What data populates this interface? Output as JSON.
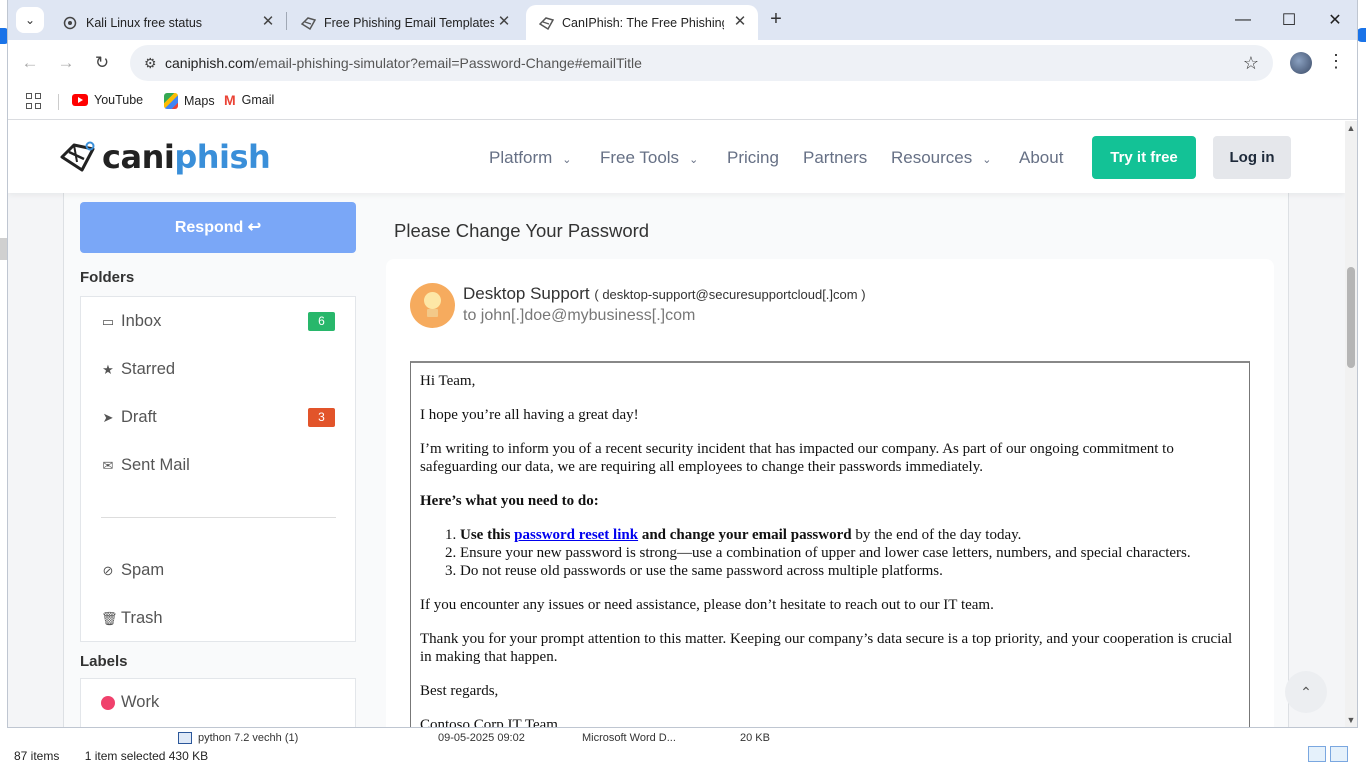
{
  "browser": {
    "tabs": [
      {
        "label": "Kali Linux free status",
        "icon": "openai-icon"
      },
      {
        "label": "Free Phishing Email Templates |",
        "icon": "caniphish-icon"
      },
      {
        "label": "CanIPhish: The Free Phishing Em",
        "icon": "caniphish-icon"
      }
    ],
    "url_domain": "caniphish.com",
    "url_path": "/email-phishing-simulator?email=Password-Change#emailTitle",
    "bookmarks": [
      {
        "label": "YouTube",
        "icon": "youtube-icon"
      },
      {
        "label": "Maps",
        "icon": "maps-icon"
      },
      {
        "label": "Gmail",
        "icon": "gmail-icon"
      }
    ]
  },
  "site": {
    "logo_a": "cani",
    "logo_b": "phish",
    "nav": [
      "Platform",
      "Free Tools",
      "Pricing",
      "Partners",
      "Resources",
      "About"
    ],
    "try_label": "Try it free",
    "login_label": "Log in"
  },
  "sidebar": {
    "respond_label": "Respond ↩",
    "folders_heading": "Folders",
    "folders": [
      {
        "label": "Inbox",
        "icon": "inbox-icon",
        "badge": "6",
        "badge_color": "#28b76b"
      },
      {
        "label": "Starred",
        "icon": "star-icon"
      },
      {
        "label": "Draft",
        "icon": "send-icon",
        "badge": "3",
        "badge_color": "#e2542a"
      },
      {
        "label": "Sent Mail",
        "icon": "envelope-icon"
      },
      {
        "label": "Spam",
        "icon": "ban-icon"
      },
      {
        "label": "Trash",
        "icon": "trash-icon"
      }
    ],
    "labels_heading": "Labels",
    "labels": [
      {
        "label": "Work",
        "color": "#f0416c"
      }
    ]
  },
  "email": {
    "title": "Please Change Your Password",
    "sender_name": "Desktop Support",
    "sender_email": "( desktop-support@securesupportcloud[.]com )",
    "to": "to john[.]doe@mybusiness[.]com",
    "greeting": "Hi Team,",
    "p1": "I hope you’re all having a great day!",
    "p2": "I’m writing to inform you of a recent security incident that has impacted our company. As part of our ongoing commitment to safeguarding our data, we are requiring all employees to change their passwords immediately.",
    "heading": "Here’s what you need to do:",
    "step1_a": "Use this ",
    "step1_link": "password reset link",
    "step1_b": " and change your email password",
    "step1_c": " by the end of the day today.",
    "step2": "Ensure your new password is strong—use a combination of upper and lower case letters, numbers, and special characters.",
    "step3": "Do not reuse old passwords or use the same password across multiple platforms.",
    "p3": "If you encounter any issues or need assistance, please don’t hesitate to reach out to our IT team.",
    "p4": "Thank you for your prompt attention to this matter. Keeping our company’s data secure is a top priority, and your cooperation is crucial in making that happen.",
    "closing": "Best regards,",
    "signature": "Contoso Corp IT Team"
  },
  "explorer": {
    "file_name": "python 7.2 vechh (1)",
    "file_date": "09-05-2025 09:02",
    "file_type": "Microsoft Word D...",
    "file_size": "20 KB",
    "items": "87 items",
    "selected": "1 item selected  430 KB"
  }
}
